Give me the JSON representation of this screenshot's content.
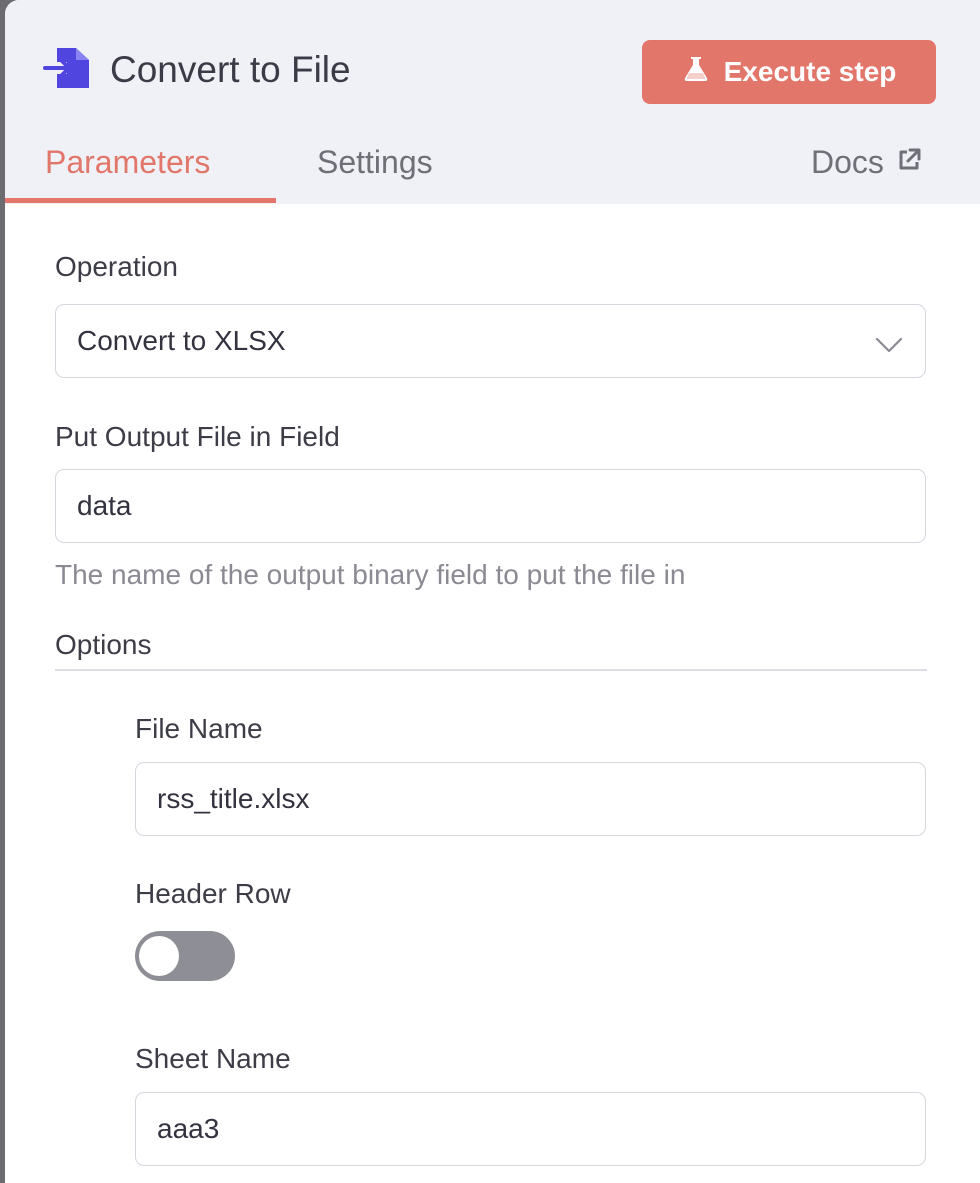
{
  "node": {
    "title": "Convert to File",
    "icon": "convert-file-icon",
    "icon_color": "#5145e0"
  },
  "toolbar": {
    "execute_label": "Execute step",
    "execute_icon": "flask-icon",
    "accent_color": "#e2766a"
  },
  "tabs": [
    {
      "label": "Parameters",
      "active": true
    },
    {
      "label": "Settings",
      "active": false
    }
  ],
  "docs": {
    "label": "Docs",
    "icon": "external-link-icon"
  },
  "params": {
    "operation": {
      "label": "Operation",
      "value": "Convert to XLSX"
    },
    "output_field": {
      "label": "Put Output File in Field",
      "value": "data",
      "hint": "The name of the output binary field to put the file in"
    },
    "options": {
      "title": "Options",
      "file_name": {
        "label": "File Name",
        "value": "rss_title.xlsx"
      },
      "header_row": {
        "label": "Header Row",
        "enabled": false
      },
      "sheet_name": {
        "label": "Sheet Name",
        "value": "aaa3"
      }
    }
  }
}
